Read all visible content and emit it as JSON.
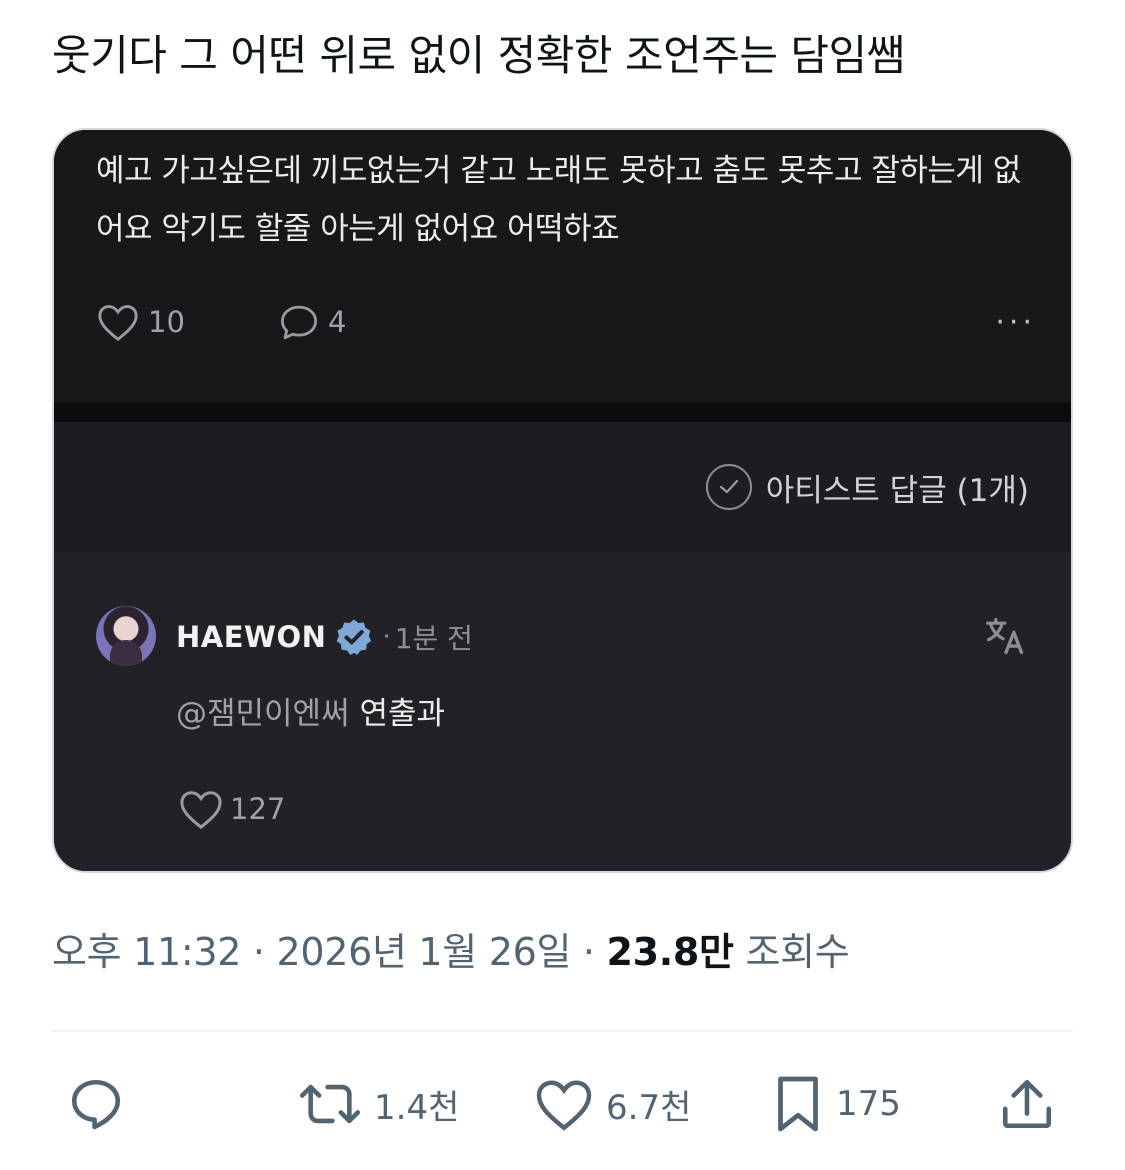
{
  "tweet": {
    "text": "웃기다 그 어떤 위로 없이 정확한 조언주는 담임쌤"
  },
  "embedded_post": {
    "text": "예고 가고싶은데 끼도없는거 같고 노래도 못하고 춤도 못추고 잘하는게 없어요 악기도 할줄 아는게 없어요 어떡하죠",
    "like_count": "10",
    "comment_count": "4",
    "more_label": "···",
    "artist_reply_label": "아티스트 답글 (1개)"
  },
  "reply": {
    "name": "HAEWON",
    "separator": "·",
    "time": "1분 전",
    "mention": "@잼민이엔써",
    "text": "연출과",
    "like_count": "127"
  },
  "meta": {
    "time": "오후 11:32",
    "separator": "·",
    "date": "2026년 1월 26일",
    "views_count": "23.8만",
    "views_label": "조회수"
  },
  "actions": {
    "retweets": "1.4천",
    "likes": "6.7천",
    "bookmarks": "175"
  },
  "icons": {
    "like": "heart-icon",
    "comment": "speech-bubble-icon",
    "more": "ellipsis-icon",
    "check": "check-circle-icon",
    "verified": "verified-badge-icon",
    "translate": "translate-icon",
    "reply": "reply-icon",
    "retweet": "retweet-icon",
    "bookmark": "bookmark-icon",
    "share": "share-icon"
  },
  "colors": {
    "card_bg": "#18181b",
    "reply_bg": "#222226",
    "verified": "#7fa8d8",
    "meta_text": "#536471"
  }
}
